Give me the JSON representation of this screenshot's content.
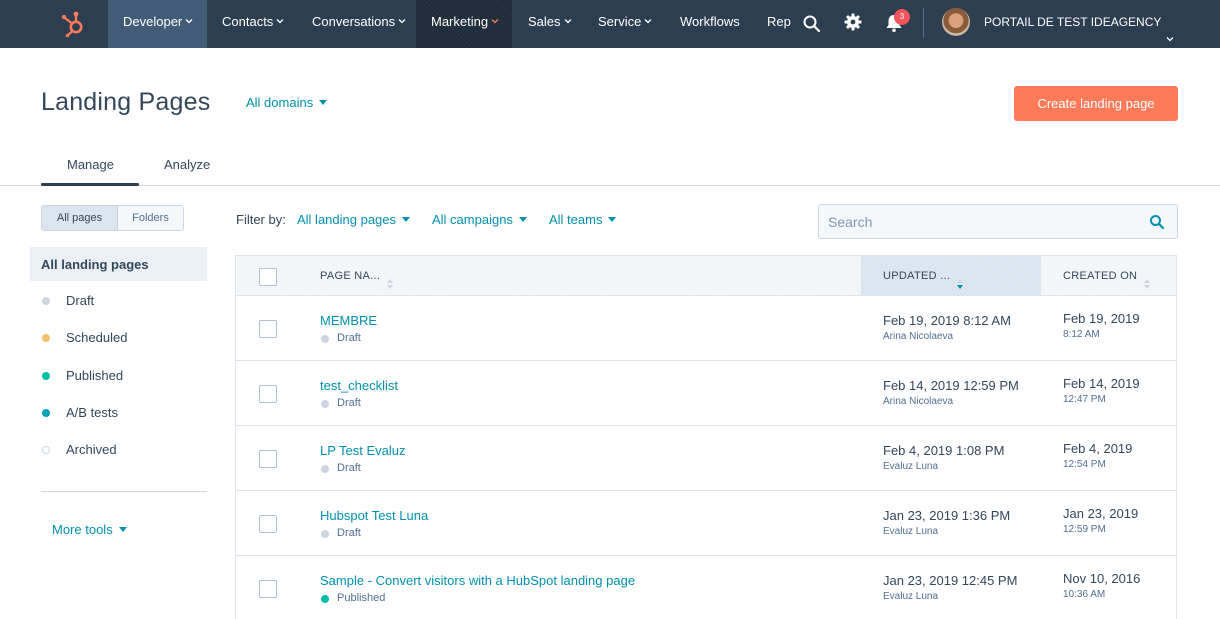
{
  "nav": {
    "logo_icon": "hubspot-sprocket-icon",
    "items": [
      {
        "label": "Developer",
        "caret": true
      },
      {
        "label": "Contacts",
        "caret": true
      },
      {
        "label": "Conversations",
        "caret": true
      },
      {
        "label": "Marketing",
        "caret": true
      },
      {
        "label": "Sales",
        "caret": true
      },
      {
        "label": "Service",
        "caret": true
      },
      {
        "label": "Workflows",
        "caret": false
      },
      {
        "label": "Repo",
        "caret": false
      }
    ],
    "search_icon": "search-icon",
    "settings_icon": "gear-icon",
    "notifications_icon": "bell-icon",
    "notifications_count": "3",
    "portal_name": "PORTAIL DE TEST IDEAGENCY"
  },
  "header": {
    "title": "Landing Pages",
    "domains_dropdown": "All domains",
    "create_button": "Create landing page"
  },
  "tabs": [
    {
      "label": "Manage",
      "active": true
    },
    {
      "label": "Analyze",
      "active": false
    }
  ],
  "sidebar": {
    "toggle": {
      "all_pages": "All pages",
      "folders": "Folders",
      "selected": "All pages"
    },
    "active_item": "All landing pages",
    "items": [
      {
        "label": "Draft",
        "color": "#cbd6e2"
      },
      {
        "label": "Scheduled",
        "color": "#f5c26b"
      },
      {
        "label": "Published",
        "color": "#00bda5"
      },
      {
        "label": "A/B tests",
        "color": "#00a4bd"
      },
      {
        "label": "Archived",
        "color": "#ffffff"
      }
    ],
    "more_tools": "More tools"
  },
  "filters": {
    "label": "Filter by:",
    "landing_pages": "All landing pages",
    "campaigns": "All campaigns",
    "teams": "All teams",
    "search_placeholder": "Search"
  },
  "table": {
    "columns": {
      "name": "PAGE NA...",
      "updated": "UPDATED ...",
      "created": "CREATED ON"
    },
    "rows": [
      {
        "name": "MEMBRE",
        "status": "Draft",
        "status_color": "#cbd6e2",
        "updated": "Feb 19, 2019 8:12 AM",
        "updated_by": "Arina Nicolaeva",
        "created_date": "Feb 19, 2019",
        "created_time": "8:12 AM"
      },
      {
        "name": "test_checklist",
        "status": "Draft",
        "status_color": "#cbd6e2",
        "updated": "Feb 14, 2019 12:59 PM",
        "updated_by": "Arina Nicolaeva",
        "created_date": "Feb 14, 2019",
        "created_time": "12:47 PM"
      },
      {
        "name": "LP Test Evaluz",
        "status": "Draft",
        "status_color": "#cbd6e2",
        "updated": "Feb 4, 2019 1:08 PM",
        "updated_by": "Evaluz Luna",
        "created_date": "Feb 4, 2019",
        "created_time": "12:54 PM"
      },
      {
        "name": "Hubspot Test Luna",
        "status": "Draft",
        "status_color": "#cbd6e2",
        "updated": "Jan 23, 2019 1:36 PM",
        "updated_by": "Evaluz Luna",
        "created_date": "Jan 23, 2019",
        "created_time": "12:59 PM"
      },
      {
        "name": "Sample - Convert visitors with a HubSpot landing page",
        "status": "Published",
        "status_color": "#00bda5",
        "updated": "Jan 23, 2019 12:45 PM",
        "updated_by": "Evaluz Luna",
        "created_date": "Nov 10, 2016",
        "created_time": "10:36 AM"
      }
    ]
  },
  "colors": {
    "nav_bg": "#2d3e50",
    "link": "#0091ae",
    "primary_button": "#ff7a59",
    "text": "#33475b"
  }
}
